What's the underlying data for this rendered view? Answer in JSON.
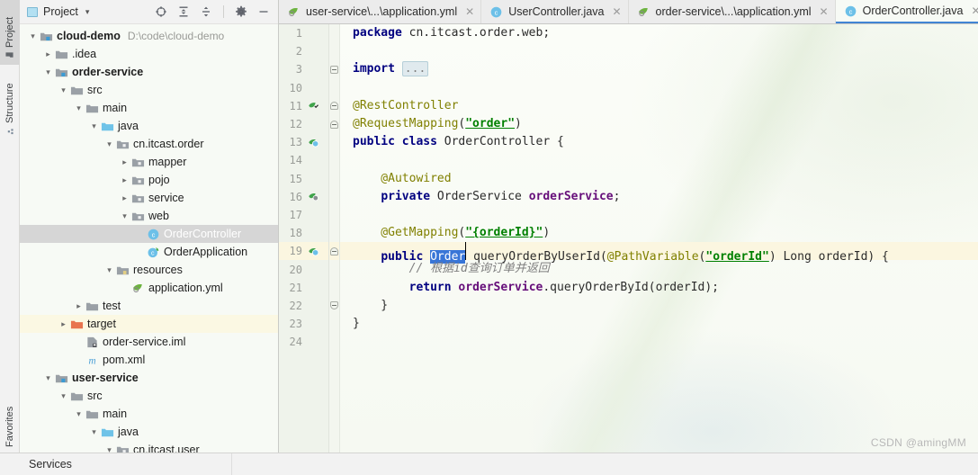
{
  "toolstrip": {
    "project_label": "Project",
    "structure_label": "Structure",
    "favorites_label": "Favorites"
  },
  "project_panel": {
    "title": "Project",
    "caret": "▾",
    "tools": [
      {
        "name": "locate-icon",
        "tip": "Select Opened File"
      },
      {
        "name": "expand-all-icon",
        "tip": "Expand All"
      },
      {
        "name": "collapse-all-icon",
        "tip": "Collapse All"
      },
      {
        "name": "settings-gear-icon",
        "tip": "Settings"
      },
      {
        "name": "hide-icon",
        "tip": "Hide"
      }
    ],
    "tree": [
      {
        "label": "cloud-demo",
        "path": "D:\\code\\cloud-demo",
        "indent": 0,
        "arrow": "down",
        "icon": "module-folder",
        "bold": true,
        "state": "normal"
      },
      {
        "label": ".idea",
        "path": "",
        "indent": 1,
        "arrow": "right",
        "icon": "folder",
        "bold": false,
        "state": "normal"
      },
      {
        "label": "order-service",
        "path": "",
        "indent": 1,
        "arrow": "down",
        "icon": "module-folder",
        "bold": true,
        "state": "normal"
      },
      {
        "label": "src",
        "path": "",
        "indent": 2,
        "arrow": "down",
        "icon": "folder",
        "bold": false,
        "state": "normal"
      },
      {
        "label": "main",
        "path": "",
        "indent": 3,
        "arrow": "down",
        "icon": "folder",
        "bold": false,
        "state": "normal"
      },
      {
        "label": "java",
        "path": "",
        "indent": 4,
        "arrow": "down",
        "icon": "source-folder",
        "bold": false,
        "state": "normal"
      },
      {
        "label": "cn.itcast.order",
        "path": "",
        "indent": 5,
        "arrow": "down",
        "icon": "package",
        "bold": false,
        "state": "normal"
      },
      {
        "label": "mapper",
        "path": "",
        "indent": 6,
        "arrow": "right",
        "icon": "package",
        "bold": false,
        "state": "normal"
      },
      {
        "label": "pojo",
        "path": "",
        "indent": 6,
        "arrow": "right",
        "icon": "package",
        "bold": false,
        "state": "normal"
      },
      {
        "label": "service",
        "path": "",
        "indent": 6,
        "arrow": "right",
        "icon": "package",
        "bold": false,
        "state": "normal"
      },
      {
        "label": "web",
        "path": "",
        "indent": 6,
        "arrow": "down",
        "icon": "package",
        "bold": false,
        "state": "normal"
      },
      {
        "label": "OrderController",
        "path": "",
        "indent": 7,
        "arrow": "none",
        "icon": "java-class",
        "bold": false,
        "state": "selected"
      },
      {
        "label": "OrderApplication",
        "path": "",
        "indent": 7,
        "arrow": "none",
        "icon": "spring-class",
        "bold": false,
        "state": "normal"
      },
      {
        "label": "resources",
        "path": "",
        "indent": 5,
        "arrow": "down",
        "icon": "resource-folder",
        "bold": false,
        "state": "normal"
      },
      {
        "label": "application.yml",
        "path": "",
        "indent": 6,
        "arrow": "none",
        "icon": "spring-yml",
        "bold": false,
        "state": "normal"
      },
      {
        "label": "test",
        "path": "",
        "indent": 3,
        "arrow": "right",
        "icon": "folder",
        "bold": false,
        "state": "normal"
      },
      {
        "label": "target",
        "path": "",
        "indent": 2,
        "arrow": "right",
        "icon": "excluded-folder",
        "bold": false,
        "state": "highlight"
      },
      {
        "label": "order-service.iml",
        "path": "",
        "indent": 3,
        "arrow": "none",
        "icon": "iml-file",
        "bold": false,
        "state": "normal"
      },
      {
        "label": "pom.xml",
        "path": "",
        "indent": 3,
        "arrow": "none",
        "icon": "maven-file",
        "bold": false,
        "state": "normal"
      },
      {
        "label": "user-service",
        "path": "",
        "indent": 1,
        "arrow": "down",
        "icon": "module-folder",
        "bold": true,
        "state": "normal"
      },
      {
        "label": "src",
        "path": "",
        "indent": 2,
        "arrow": "down",
        "icon": "folder",
        "bold": false,
        "state": "normal"
      },
      {
        "label": "main",
        "path": "",
        "indent": 3,
        "arrow": "down",
        "icon": "folder",
        "bold": false,
        "state": "normal"
      },
      {
        "label": "java",
        "path": "",
        "indent": 4,
        "arrow": "down",
        "icon": "source-folder",
        "bold": false,
        "state": "normal"
      },
      {
        "label": "cn.itcast.user",
        "path": "",
        "indent": 5,
        "arrow": "down",
        "icon": "package",
        "bold": false,
        "state": "normal"
      }
    ]
  },
  "editor": {
    "tabs": [
      {
        "label": "user-service\\...\\application.yml",
        "icon": "spring-yml",
        "active": false,
        "closable": true
      },
      {
        "label": "UserController.java",
        "icon": "java-class",
        "active": false,
        "closable": true
      },
      {
        "label": "order-service\\...\\application.yml",
        "icon": "spring-yml",
        "active": false,
        "closable": true
      },
      {
        "label": "OrderController.java",
        "icon": "java-class",
        "active": true,
        "closable": true
      }
    ],
    "lines": [
      {
        "num": "1",
        "gutter": "",
        "fold": "",
        "hl": false,
        "tokens": [
          {
            "t": "package",
            "c": "kw"
          },
          {
            "t": " cn.itcast.order.web;",
            "c": "plain"
          }
        ]
      },
      {
        "num": "2",
        "gutter": "",
        "fold": "",
        "hl": false,
        "tokens": []
      },
      {
        "num": "3",
        "gutter": "",
        "fold": "plus",
        "hl": false,
        "tokens": [
          {
            "t": "import",
            "c": "kw"
          },
          {
            "t": " ",
            "c": "plain"
          },
          {
            "t": "...",
            "c": "importfold"
          }
        ]
      },
      {
        "num": "10",
        "gutter": "",
        "fold": "",
        "hl": false,
        "tokens": []
      },
      {
        "num": "11",
        "gutter": "spring-bean",
        "fold": "round",
        "hl": false,
        "tokens": [
          {
            "t": "@RestController",
            "c": "ann"
          }
        ]
      },
      {
        "num": "12",
        "gutter": "",
        "fold": "round",
        "hl": false,
        "tokens": [
          {
            "t": "@RequestMapping",
            "c": "ann"
          },
          {
            "t": "(",
            "c": "plain"
          },
          {
            "t": "\"order\"",
            "c": "strul"
          },
          {
            "t": ")",
            "c": "plain"
          }
        ]
      },
      {
        "num": "13",
        "gutter": "spring-bean-class",
        "fold": "",
        "hl": false,
        "tokens": [
          {
            "t": "public class",
            "c": "kw"
          },
          {
            "t": " OrderController {",
            "c": "plain"
          }
        ]
      },
      {
        "num": "14",
        "gutter": "",
        "fold": "",
        "hl": false,
        "tokens": []
      },
      {
        "num": "15",
        "gutter": "",
        "fold": "",
        "hl": false,
        "tokens": [
          {
            "t": "    @Autowired",
            "c": "ann"
          }
        ]
      },
      {
        "num": "16",
        "gutter": "spring-autowired",
        "fold": "",
        "hl": false,
        "tokens": [
          {
            "t": "    ",
            "c": "plain"
          },
          {
            "t": "private",
            "c": "kw"
          },
          {
            "t": " OrderService ",
            "c": "plain"
          },
          {
            "t": "orderService",
            "c": "fld"
          },
          {
            "t": ";",
            "c": "plain"
          }
        ]
      },
      {
        "num": "17",
        "gutter": "",
        "fold": "",
        "hl": false,
        "tokens": []
      },
      {
        "num": "18",
        "gutter": "",
        "fold": "",
        "hl": false,
        "tokens": [
          {
            "t": "    @GetMapping",
            "c": "ann"
          },
          {
            "t": "(",
            "c": "plain"
          },
          {
            "t": "\"{orderId}\"",
            "c": "strul"
          },
          {
            "t": ")",
            "c": "plain"
          }
        ]
      },
      {
        "num": "19",
        "gutter": "spring-bean-class",
        "fold": "round",
        "hl": true,
        "tokens": [
          {
            "t": "    ",
            "c": "plain"
          },
          {
            "t": "public",
            "c": "kw"
          },
          {
            "t": " ",
            "c": "plain"
          },
          {
            "t": "Order",
            "c": "sel"
          },
          {
            "t": "│",
            "c": "caretbar"
          },
          {
            "t": " queryOrderByUserId(",
            "c": "plain"
          },
          {
            "t": "@PathVariable",
            "c": "ann"
          },
          {
            "t": "(",
            "c": "plain"
          },
          {
            "t": "\"orderId\"",
            "c": "strul"
          },
          {
            "t": ") Long orderId) {",
            "c": "plain"
          }
        ]
      },
      {
        "num": "20",
        "gutter": "",
        "fold": "",
        "hl": false,
        "tokens": [
          {
            "t": "        // 根据id查询订单并返回",
            "c": "cmt"
          }
        ]
      },
      {
        "num": "21",
        "gutter": "",
        "fold": "",
        "hl": false,
        "tokens": [
          {
            "t": "        ",
            "c": "plain"
          },
          {
            "t": "return",
            "c": "kw"
          },
          {
            "t": " ",
            "c": "plain"
          },
          {
            "t": "orderService",
            "c": "fld"
          },
          {
            "t": ".queryOrderById(orderId);",
            "c": "plain"
          }
        ]
      },
      {
        "num": "22",
        "gutter": "",
        "fold": "bot",
        "hl": false,
        "tokens": [
          {
            "t": "    }",
            "c": "plain"
          }
        ]
      },
      {
        "num": "23",
        "gutter": "",
        "fold": "",
        "hl": false,
        "tokens": [
          {
            "t": "}",
            "c": "plain"
          }
        ]
      },
      {
        "num": "24",
        "gutter": "",
        "fold": "",
        "hl": false,
        "tokens": []
      }
    ]
  },
  "status_bar": {
    "items": [
      {
        "label": "Services",
        "name": "status-services"
      }
    ]
  },
  "watermark": "CSDN @amingMM",
  "colors": {
    "accent_blue": "#4184d3",
    "selection_blue": "#3875d7",
    "keyword": "#000080",
    "annotation": "#808000",
    "string": "#008000",
    "field": "#660e7a",
    "comment": "#808080",
    "editor_bg": "#f7faf5",
    "panel_bg": "#f2f2f2",
    "tree_selection": "#d6d6d6",
    "line_highlight": "#fbf6e0",
    "excluded_folder": "#e8744f"
  }
}
